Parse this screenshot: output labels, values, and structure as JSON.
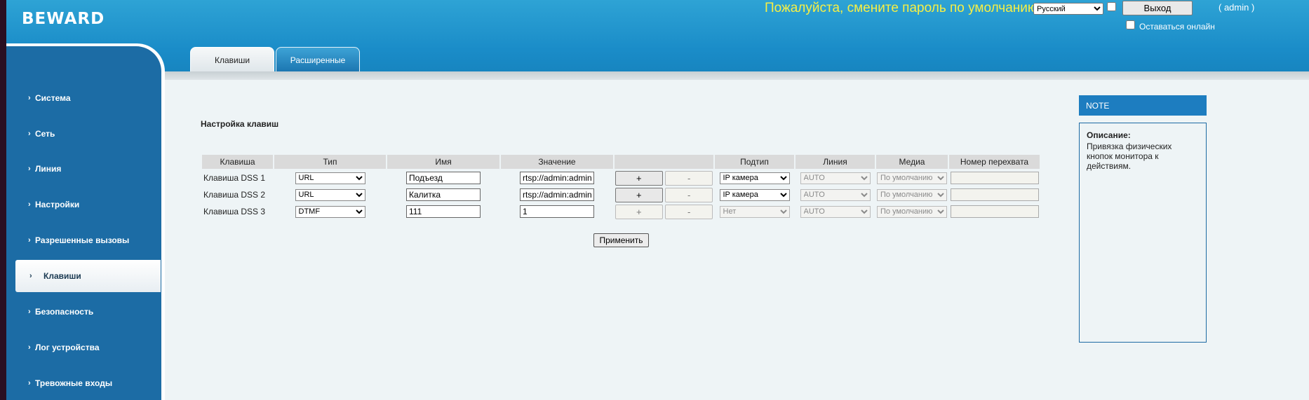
{
  "header": {
    "logo": "BEWARD",
    "password_warning": "Пожалуйста, смените пароль по умолчанию",
    "language_selected": "Русский",
    "logout_label": "Выход",
    "user_label": "( admin )",
    "stay_online_label": "Оставаться онлайн"
  },
  "tabs": [
    {
      "label": "Клавиши",
      "active": false
    },
    {
      "label": "Расширенные",
      "active": true
    }
  ],
  "sidebar": {
    "items": [
      {
        "label": "Система"
      },
      {
        "label": "Сеть"
      },
      {
        "label": "Линия"
      },
      {
        "label": "Настройки"
      },
      {
        "label": "Разрешенные вызовы"
      },
      {
        "label": "Клавиши",
        "active": true
      },
      {
        "label": "Безопасность"
      },
      {
        "label": "Лог устройства"
      },
      {
        "label": "Тревожные входы"
      }
    ]
  },
  "main": {
    "section_title": "Настройка клавиш",
    "columns": [
      "Клавиша",
      "Тип",
      "Имя",
      "Значение",
      "",
      "Подтип",
      "Линия",
      "Медиа",
      "Номер перехвата"
    ],
    "rows": [
      {
        "key": "Клавиша DSS 1",
        "type": "URL",
        "name": "Подъезд",
        "value": "rtsp://admin:admin",
        "plus": "+",
        "minus": "-",
        "subtype": "IP камера",
        "line": "AUTO",
        "media": "По умолчанию",
        "intercept": ""
      },
      {
        "key": "Клавиша DSS 2",
        "type": "URL",
        "name": "Калитка",
        "value": "rtsp://admin:admin",
        "plus": "+",
        "minus": "-",
        "subtype": "IP камера",
        "line": "AUTO",
        "media": "По умолчанию",
        "intercept": ""
      },
      {
        "key": "Клавиша DSS 3",
        "type": "DTMF",
        "name": "111",
        "value": "1",
        "plus": "+",
        "minus": "-",
        "subtype": "Нет",
        "line": "AUTO",
        "media": "По умолчанию",
        "intercept": ""
      }
    ],
    "apply_label": "Применить"
  },
  "note": {
    "header": "NOTE",
    "title": "Описание:",
    "text": "Привязка физических кнопок монитора к действиям."
  },
  "colors": {
    "header_blue": "#1a8cc8",
    "sidebar_blue": "#1c6ca5",
    "warning_yellow": "#f6ef45",
    "note_blue": "#1d7dc0"
  }
}
